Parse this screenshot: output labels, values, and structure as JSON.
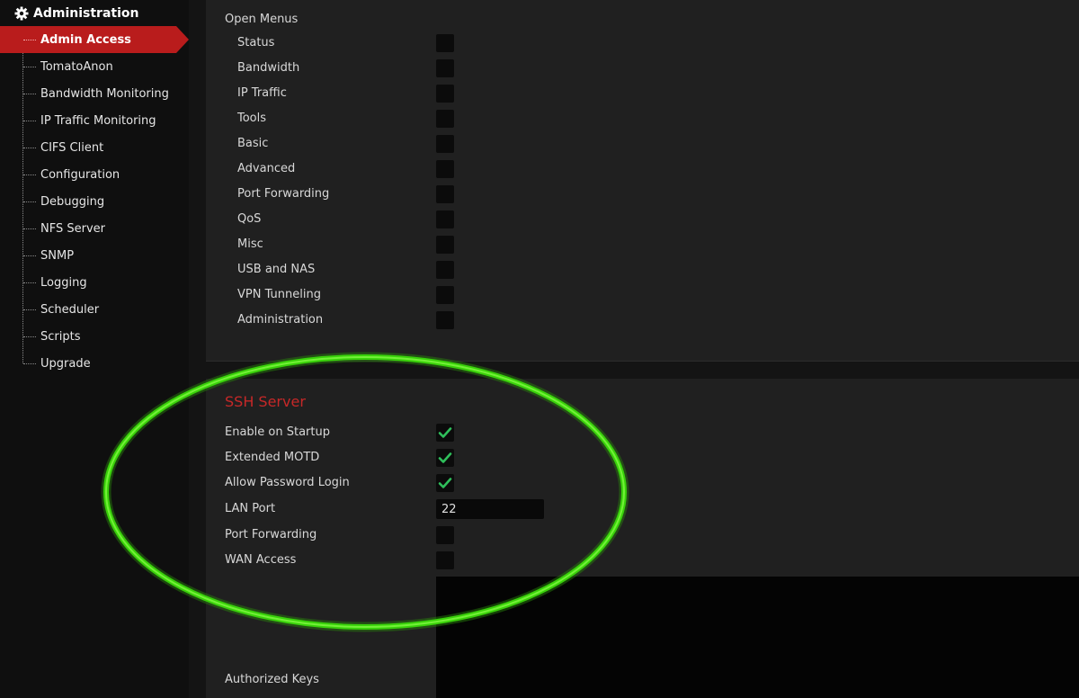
{
  "sidebar": {
    "section_title": "Administration",
    "section_icon": "gear-icon",
    "items": [
      {
        "label": "Admin Access",
        "active": true
      },
      {
        "label": "TomatoAnon"
      },
      {
        "label": "Bandwidth Monitoring"
      },
      {
        "label": "IP Traffic Monitoring"
      },
      {
        "label": "CIFS Client"
      },
      {
        "label": "Configuration"
      },
      {
        "label": "Debugging"
      },
      {
        "label": "NFS Server"
      },
      {
        "label": "SNMP"
      },
      {
        "label": "Logging"
      },
      {
        "label": "Scheduler"
      },
      {
        "label": "Scripts"
      },
      {
        "label": "Upgrade"
      }
    ]
  },
  "open_menus": {
    "title": "Open Menus",
    "items": [
      {
        "label": "Status",
        "checked": false
      },
      {
        "label": "Bandwidth",
        "checked": false
      },
      {
        "label": "IP Traffic",
        "checked": false
      },
      {
        "label": "Tools",
        "checked": false
      },
      {
        "label": "Basic",
        "checked": false
      },
      {
        "label": "Advanced",
        "checked": false
      },
      {
        "label": "Port Forwarding",
        "checked": false
      },
      {
        "label": "QoS",
        "checked": false
      },
      {
        "label": "Misc",
        "checked": false
      },
      {
        "label": "USB and NAS",
        "checked": false
      },
      {
        "label": "VPN Tunneling",
        "checked": false
      },
      {
        "label": "Administration",
        "checked": false
      }
    ]
  },
  "ssh": {
    "title": "SSH Server",
    "enable_on_startup": {
      "label": "Enable on Startup",
      "checked": true
    },
    "extended_motd": {
      "label": "Extended MOTD",
      "checked": true
    },
    "allow_password_login": {
      "label": "Allow Password Login",
      "checked": true
    },
    "lan_port": {
      "label": "LAN Port",
      "value": "22"
    },
    "port_forwarding": {
      "label": "Port Forwarding",
      "checked": false
    },
    "wan_access": {
      "label": "WAN Access",
      "checked": false
    },
    "authorized_keys": {
      "label": "Authorized Keys",
      "value": ""
    }
  },
  "colors": {
    "accent_red": "#b91c1c",
    "title_red": "#c62828",
    "check_green": "#2fbf5b",
    "highlight_green": "#3ad80a"
  }
}
